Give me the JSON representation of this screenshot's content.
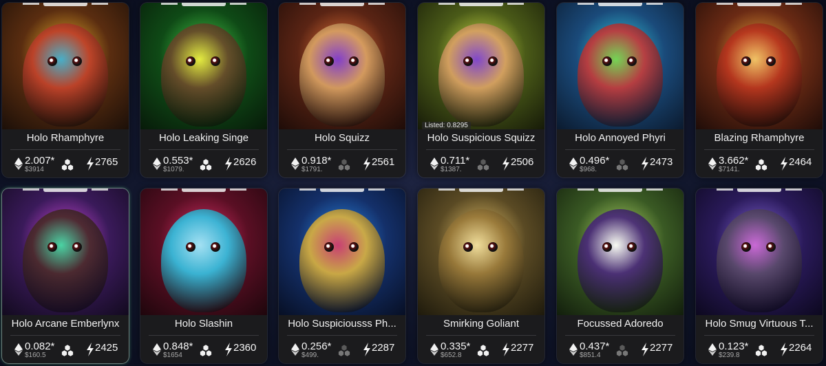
{
  "cards": [
    {
      "name": "Holo Rhamphyre",
      "price": "2.007*",
      "usd": "$3914",
      "power": "2765",
      "listed": "",
      "hex": "white",
      "bg": [
        "#f1b42b",
        "#5a2d10",
        "#1b0f08"
      ],
      "body": "#c0412a",
      "accent": "#3bb0d6"
    },
    {
      "name": "Holo Leaking Singe",
      "price": "0.553*",
      "usd": "$1079.",
      "power": "2626",
      "listed": "",
      "hex": "white",
      "bg": [
        "#4ad14a",
        "#0f4a16",
        "#071a09"
      ],
      "body": "#6a4a2a",
      "accent": "#f2f040"
    },
    {
      "name": "Holo Squizz",
      "price": "0.918*",
      "usd": "$1791.",
      "power": "2561",
      "listed": "",
      "hex": "grey",
      "bg": [
        "#f0793a",
        "#5a2414",
        "#1e0c08"
      ],
      "body": "#d9a163",
      "accent": "#7a3bd6"
    },
    {
      "name": "Holo Suspicious Squizz",
      "price": "0.711*",
      "usd": "$1387.",
      "power": "2506",
      "listed": "Listed: 0.8295",
      "hex": "grey",
      "bg": [
        "#d6e84a",
        "#4a5a18",
        "#161a08"
      ],
      "body": "#d9a163",
      "accent": "#7a3bd6"
    },
    {
      "name": "Holo Annoyed Phyri",
      "price": "0.496*",
      "usd": "$968.",
      "power": "2473",
      "listed": "",
      "hex": "grey",
      "bg": [
        "#35d0e0",
        "#1a4a7a",
        "#0b1a2e"
      ],
      "body": "#c23a3a",
      "accent": "#7ad64a"
    },
    {
      "name": "Blazing Rhamphyre",
      "price": "3.662*",
      "usd": "$7141.",
      "power": "2464",
      "listed": "",
      "hex": "white",
      "bg": [
        "#f3a83a",
        "#6a2a14",
        "#1e0c08"
      ],
      "body": "#b8351e",
      "accent": "#f1c66a"
    },
    {
      "name": "Holo Arcane Emberlynx",
      "price": "0.082*",
      "usd": "$160.5",
      "power": "2425",
      "listed": "",
      "hex": "white",
      "bg": [
        "#d64adf",
        "#3a1a5a",
        "#120a1e"
      ],
      "body": "#4a2a2a",
      "accent": "#40e0a0"
    },
    {
      "name": "Holo Slashin",
      "price": "0.848*",
      "usd": "$1654",
      "power": "2360",
      "listed": "",
      "hex": "white",
      "bg": [
        "#e0306a",
        "#5a0f24",
        "#1e060c"
      ],
      "body": "#35c0e0",
      "accent": "#a0f0ff"
    },
    {
      "name": "Holo Suspiciousss Ph...",
      "price": "0.256*",
      "usd": "$499.",
      "power": "2287",
      "listed": "",
      "hex": "grey",
      "bg": [
        "#2a8ae8",
        "#14306a",
        "#070f24"
      ],
      "body": "#d8b040",
      "accent": "#d63a6a"
    },
    {
      "name": "Smirking Goliant",
      "price": "0.335*",
      "usd": "$652.8",
      "power": "2277",
      "listed": "",
      "hex": "white",
      "bg": [
        "#e8c46a",
        "#5a4a24",
        "#1e1a0c"
      ],
      "body": "#9a7a3a",
      "accent": "#f1e0a0"
    },
    {
      "name": "Focussed Adoredo",
      "price": "0.437*",
      "usd": "$851.4",
      "power": "2277",
      "listed": "",
      "hex": "grey",
      "bg": [
        "#b8e06a",
        "#3a5a24",
        "#121e0c"
      ],
      "body": "#4a2a7a",
      "accent": "#ffffff"
    },
    {
      "name": "Holo Smug Virtuous T...",
      "price": "0.123*",
      "usd": "$239.8",
      "power": "2264",
      "listed": "",
      "hex": "white",
      "bg": [
        "#8a6ae0",
        "#2a1a5a",
        "#0c081e"
      ],
      "body": "#5a4a6a",
      "accent": "#d06ad6"
    }
  ]
}
